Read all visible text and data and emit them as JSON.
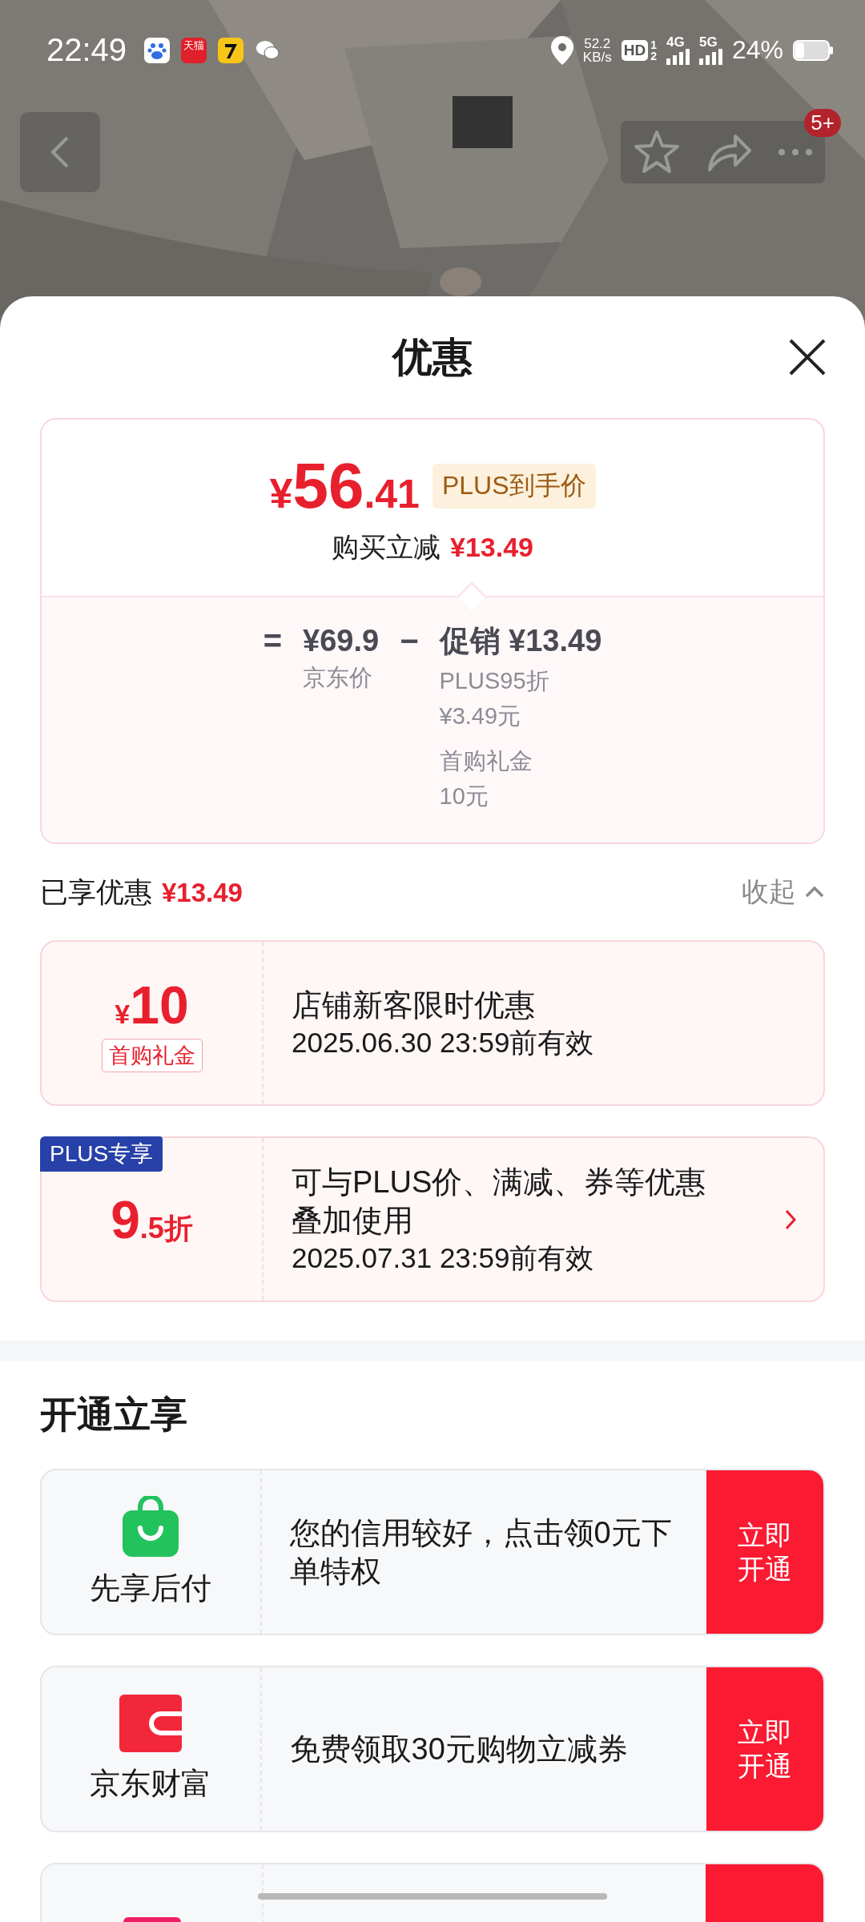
{
  "status_bar": {
    "time": "22:49",
    "notification_icons": [
      {
        "kind": "paw"
      },
      {
        "kind": "tmall",
        "label": "天猫"
      },
      {
        "kind": "seven"
      },
      {
        "kind": "chat"
      }
    ],
    "net_speed": "52.2",
    "net_unit": "KB/s",
    "hd": "HD",
    "sims": [
      "1",
      "2"
    ],
    "signals": [
      "4G",
      "5G"
    ],
    "battery": "24%"
  },
  "nav": {
    "badge": "5+"
  },
  "sheet": {
    "title": "优惠"
  },
  "price_card": {
    "currency": "¥",
    "price_integer": "56",
    "price_decimal": ".41",
    "badge": "PLUS到手价",
    "instant_label": "购买立减",
    "instant_amount": "¥13.49",
    "equals": "=",
    "base_price": "¥69.9",
    "base_label": "京东价",
    "minus": "−",
    "promo_label": "促销",
    "promo_amount": "¥13.49",
    "promo_items": [
      {
        "name": "PLUS95折",
        "amount": "¥3.49元"
      },
      {
        "name": "首购礼金",
        "amount": "10元"
      }
    ]
  },
  "enjoyed": {
    "label": "已享优惠",
    "amount": "¥13.49",
    "collapse": "收起"
  },
  "coupons": [
    {
      "kind": "cash",
      "currency": "¥",
      "value": "10",
      "tag": "首购礼金",
      "title": "店铺新客限时优惠",
      "validity": "2025.06.30 23:59前有效",
      "arrow": false
    },
    {
      "kind": "discount",
      "corner_tag": "PLUS专享",
      "value": "9",
      "value_suffix": ".5折",
      "title": "可与PLUS价、满减、券等优惠叠加使用",
      "validity": "2025.07.31 23:59前有效",
      "arrow": true
    }
  ],
  "offers": {
    "title": "开通立享",
    "items": [
      {
        "kind": "bag",
        "name": "先享后付",
        "desc": "您的信用较好，点击领0元下单特权",
        "button": "立即开通"
      },
      {
        "kind": "wallet",
        "name": "京东财富",
        "desc": "免费领取30元购物立减券",
        "button": "立即开通"
      },
      {
        "kind": "card"
      }
    ]
  }
}
